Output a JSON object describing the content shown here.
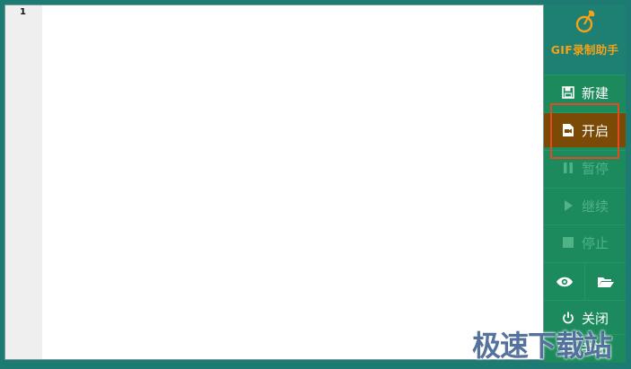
{
  "editor": {
    "line_number": "1"
  },
  "app": {
    "title": "GIF录制助手"
  },
  "buttons": {
    "save": "新建",
    "start": "开启",
    "pause": "暂停",
    "resume": "继续",
    "stop": "停止",
    "close": "关闭",
    "close_lower": "关闭"
  },
  "icons": {
    "logo": "leaf-logo-icon",
    "save": "floppy-disk-icon",
    "start": "record-file-icon",
    "pause": "pause-icon",
    "resume": "play-icon",
    "stop": "stop-icon",
    "preview": "eye-icon",
    "folder": "folder-open-icon",
    "close": "power-icon"
  },
  "watermark": "极速下载站",
  "colors": {
    "frame": "#1e7b74",
    "panel": "#1c8a5d",
    "active_button": "#7a4a06",
    "logo_text": "#f3a21a",
    "highlight": "#e34a22"
  }
}
